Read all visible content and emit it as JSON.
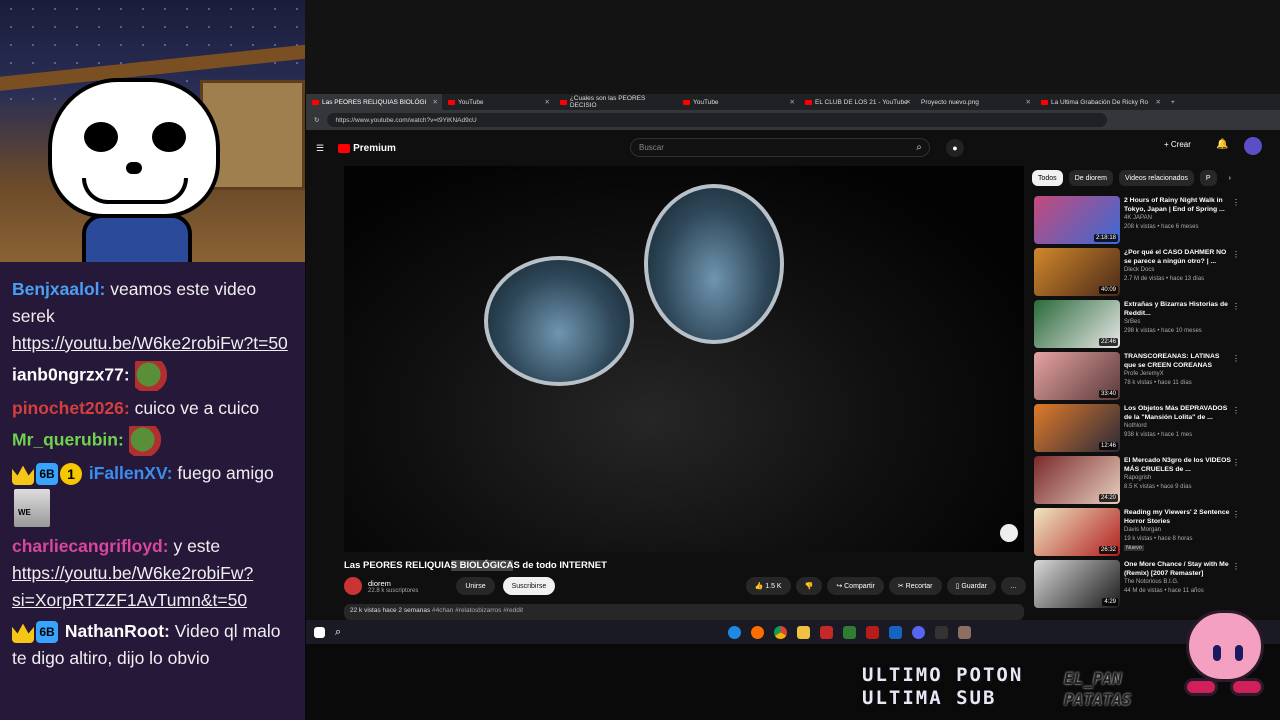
{
  "chat": [
    {
      "user": "Benjxaalol",
      "color": "#4a9ff5",
      "text": "veamos este video serek",
      "link": "https://youtu.be/W6ke2robiFw?t=50"
    },
    {
      "user": "ianb0ngrzx77",
      "color": "#ffffff",
      "emote": "pepe-emote"
    },
    {
      "user": "pinochet2026",
      "color": "#d33f3f",
      "text": "cuico ve a cuico"
    },
    {
      "user": "Mr_querubin",
      "color": "#6fd34d",
      "emote": "pepe-emote"
    },
    {
      "user": "iFallenXV",
      "color": "#3b8ef0",
      "text": "fuego amigo",
      "badge_bits": "6B",
      "badge_one": "1"
    },
    {
      "user": "charliecangrifloyd",
      "color": "#d9469e",
      "text": "y este",
      "link": "https://youtu.be/W6ke2robiFw?si=XorpRTZZF1AvTumn&t=50"
    },
    {
      "user": "NathanRoot",
      "color": "#ffffff",
      "text": "Video ql malo te digo altiro, dijo lo obvio",
      "badge_bits": "6B"
    }
  ],
  "chat_avatar_text": "WE",
  "browser": {
    "tabs": [
      {
        "label": "Las PEORES RELIQUIAS BIOLÓGI"
      },
      {
        "label": "YouTube"
      },
      {
        "label": "¿Cuales son las PEORES DECISIO"
      },
      {
        "label": "YouTube"
      },
      {
        "label": "EL CLUB DE LOS 21 - YouTube"
      },
      {
        "label": "Proyecto nuevo.png"
      },
      {
        "label": "La Ultima Grabación De Ricky Ro"
      }
    ],
    "url": "https://www.youtube.com/watch?v=t9YiKNAd9cU"
  },
  "youtube": {
    "logo": "Premium",
    "search_placeholder": "Buscar",
    "create_label": "Crear",
    "title_pre": "Las PEORES RELIQUIA",
    "title_hl": "S BIOLÓGICA",
    "title_post": "S de todo INTERNET",
    "channel": "diorem",
    "subs": "22.8 k suscriptores",
    "join": "Unirse",
    "subscribe": "Suscribirse",
    "likes": "1.5 K",
    "share": "Compartir",
    "clip": "Recortar",
    "save": "Guardar",
    "more": "…",
    "views_date": "22 k vistas  hace 2 semanas",
    "tags": "#4chan #relatosbizarros #reddit",
    "chips": [
      "Todos",
      "De diorem",
      "Videos relacionados",
      "P"
    ],
    "recs": [
      {
        "title": "2 Hours of Rainy Night Walk in Tokyo, Japan | End of Spring ...",
        "channel": "4K JAPAN",
        "meta": "208 k vistas • hace 6 meses",
        "dur": "2:18:18",
        "c1": "#c54a7a",
        "c2": "#3a6ad6"
      },
      {
        "title": "¿Por qué el CASO DAHMER NO se parece a ningún otro? | ...",
        "channel": "Dleck Docs",
        "meta": "2.7 M de vistas • hace 13 días",
        "dur": "40:09",
        "c1": "#d1882a",
        "c2": "#4a2a1a"
      },
      {
        "title": "Extrañas y Bizarras Historias de Reddit...",
        "channel": "SrBes",
        "meta": "298 k vistas • hace 10 meses",
        "dur": "22:46",
        "c1": "#2a6a3a",
        "c2": "#e8e8e8"
      },
      {
        "title": "TRANSCOREANAS: LATINAS que se CREEN COREANAS",
        "channel": "Profe JeremyX",
        "meta": "78 k vistas • hace 11 días",
        "dur": "33:40",
        "c1": "#e6a2a2",
        "c2": "#5a3a3a"
      },
      {
        "title": "Los Objetos Más DEPRAVADOS de la \"Mansión Lolita\" de ...",
        "channel": "Nothlord",
        "meta": "938 k vistas • hace 1 mes",
        "dur": "12:46",
        "c1": "#e07a2a",
        "c2": "#2a2a3a"
      },
      {
        "title": "El Mercado N3gro de los VIDEOS MÁS CRUELES de ...",
        "channel": "Rapogrish",
        "meta": "8.5 K vistas • hace 9 días",
        "dur": "24:20",
        "c1": "#7a2a2a",
        "c2": "#e8d0c0"
      },
      {
        "title": "Reading my Viewers' 2 Sentence Horror Stories",
        "channel": "Davis Morgan",
        "meta": "19 k vistas • hace 8 horas",
        "dur": "26:32",
        "badge": "Nuevo",
        "c1": "#f0e6c0",
        "c2": "#b02020"
      },
      {
        "title": "One More Chance / Stay with Me (Remix) [2007 Remaster]",
        "channel": "The Notorious B.I.G.",
        "meta": "44 M de vistas • hace 11 años",
        "dur": "4:29",
        "c1": "#d8d8d8",
        "c2": "#1a1a1a"
      }
    ]
  },
  "overlay": {
    "line1": "ULTIMO POTON",
    "line2": "ULTIMA SUB",
    "tag1": "EL_PAN",
    "tag2": "PATATAS"
  },
  "colors": {
    "chat_bg": "#261838",
    "yt_red": "#ff0000",
    "kirby": "#f4a0c0"
  }
}
